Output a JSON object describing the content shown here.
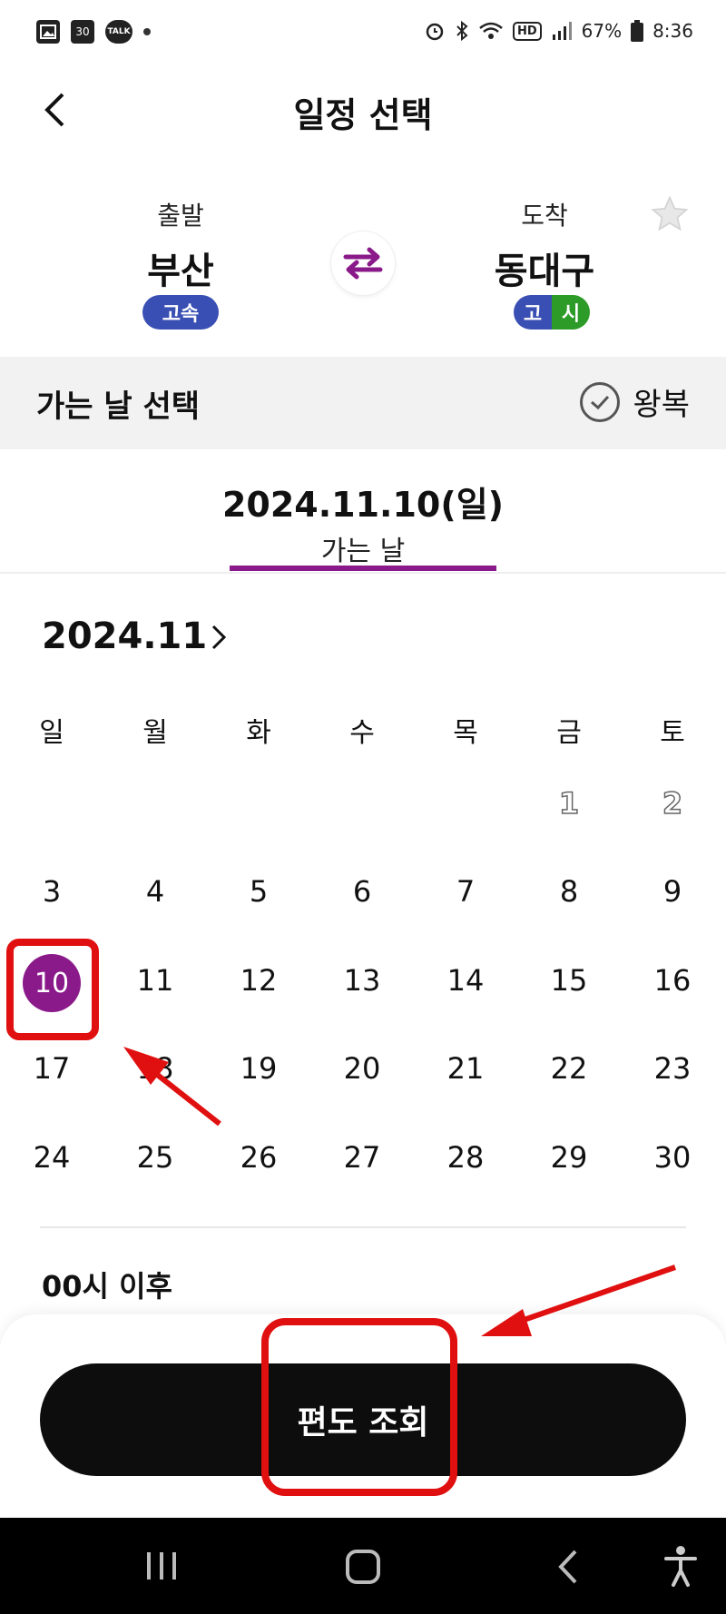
{
  "status_bar": {
    "left_icons": [
      "gallery-icon",
      "calendar-30-icon",
      "kakaotalk-icon",
      "dot-icon"
    ],
    "calendar_badge": "30",
    "talk_badge": "TALK",
    "right_icons": [
      "alarm-icon",
      "bluetooth-icon",
      "wifi-icon",
      "hd-icon",
      "signal-icon",
      "battery-icon"
    ],
    "hd": "HD",
    "battery": "67%",
    "time": "8:36"
  },
  "header": {
    "title": "일정 선택"
  },
  "route": {
    "departure": {
      "label": "출발",
      "city": "부산",
      "tags": [
        "고속"
      ]
    },
    "arrival": {
      "label": "도착",
      "city": "동대구",
      "tags": [
        "고",
        "시"
      ]
    }
  },
  "date_select": {
    "title": "가는 날 선택",
    "roundtrip_label": "왕복"
  },
  "selected": {
    "date": "2024.11.10(일)",
    "tab_label": "가는 날"
  },
  "calendar": {
    "month": "2024.11",
    "weekdays": [
      "일",
      "월",
      "화",
      "수",
      "목",
      "금",
      "토"
    ],
    "weeks": [
      [
        "",
        "",
        "",
        "",
        "",
        "1",
        "2"
      ],
      [
        "3",
        "4",
        "5",
        "6",
        "7",
        "8",
        "9"
      ],
      [
        "10",
        "11",
        "12",
        "13",
        "14",
        "15",
        "16"
      ],
      [
        "17",
        "18",
        "19",
        "20",
        "21",
        "22",
        "23"
      ],
      [
        "24",
        "25",
        "26",
        "27",
        "28",
        "29",
        "30"
      ]
    ],
    "selected_day": "10",
    "past_outlined_days": [
      "1",
      "2"
    ]
  },
  "time_filter": {
    "label": "00시 이후"
  },
  "cta": {
    "label": "편도 조회"
  },
  "colors": {
    "accent": "#8a1a8a",
    "express_tag": "#3a4fb3",
    "intercity_tag": "#2d9b27",
    "annotation": "#e01010",
    "button": "#0d0d0d"
  },
  "nav_bar": {
    "icons": [
      "recent-apps-icon",
      "home-icon",
      "back-icon",
      "accessibility-icon"
    ]
  }
}
